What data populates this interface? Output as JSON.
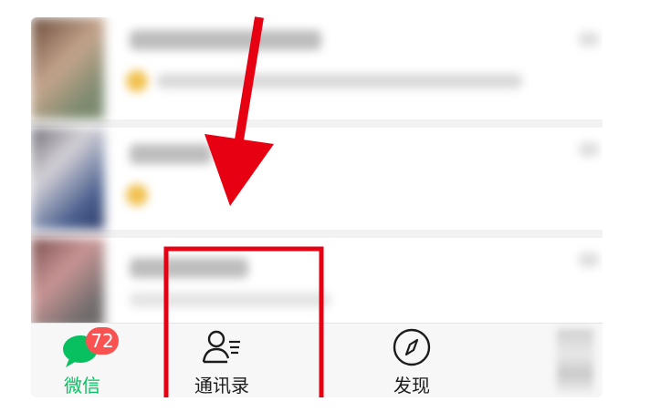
{
  "tabbar": {
    "tabs": [
      {
        "label": "微信",
        "badge": "72",
        "active": true,
        "icon": "chat-bubble-icon"
      },
      {
        "label": "通讯录",
        "active": false,
        "icon": "contacts-icon"
      },
      {
        "label": "发现",
        "active": false,
        "icon": "compass-icon"
      },
      {
        "label": "",
        "active": false,
        "icon": "me-icon"
      }
    ]
  },
  "annotation": {
    "arrow_color": "#e60012",
    "highlight_color": "#e60012"
  },
  "colors": {
    "wechat_green": "#07c160",
    "badge_red": "#fa5151"
  }
}
